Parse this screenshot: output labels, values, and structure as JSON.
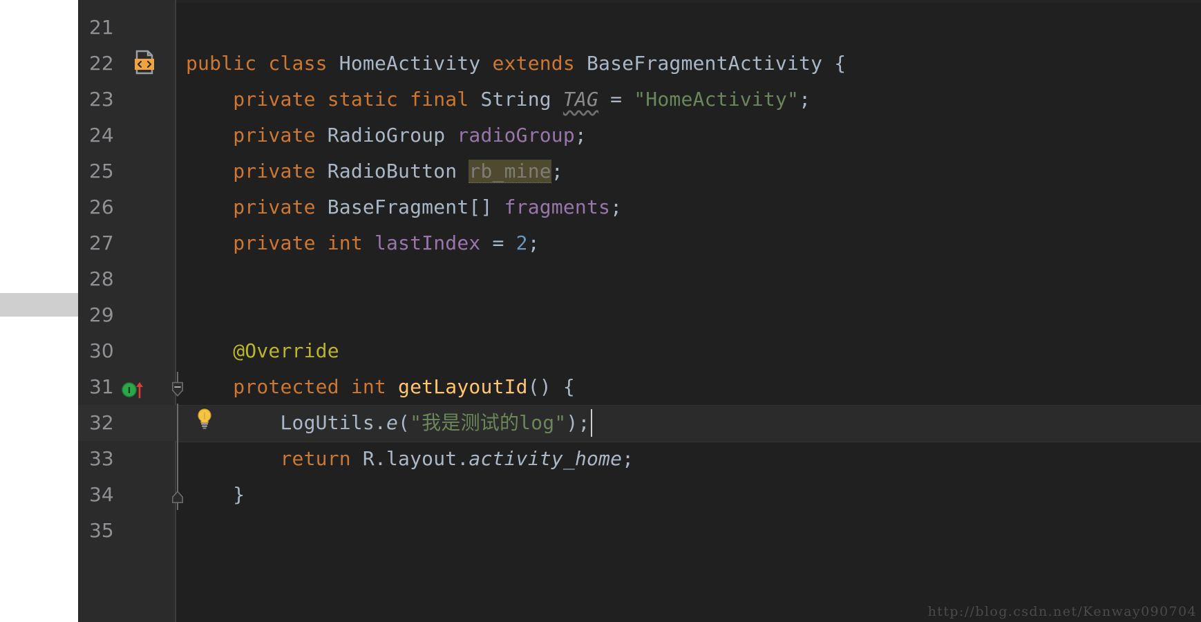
{
  "editor": {
    "theme": "darcula",
    "background": "#202020",
    "gutter_background": "#2b2b2c",
    "first_line_number": 21,
    "current_line_number": 32,
    "lines": [
      {
        "number": "21",
        "segments": []
      },
      {
        "number": "22",
        "segments": [
          {
            "text": "public ",
            "cls": "kw"
          },
          {
            "text": "class ",
            "cls": "kw"
          },
          {
            "text": "HomeActivity ",
            "cls": "type"
          },
          {
            "text": "extends ",
            "cls": "kw"
          },
          {
            "text": "BaseFragmentActivity ",
            "cls": "type"
          },
          {
            "text": "{",
            "cls": "punc"
          }
        ]
      },
      {
        "number": "23",
        "segments": [
          {
            "text": "    private ",
            "cls": "kw"
          },
          {
            "text": "static ",
            "cls": "kw"
          },
          {
            "text": "final ",
            "cls": "kw"
          },
          {
            "text": "String ",
            "cls": "type"
          },
          {
            "text": "TAG",
            "cls": "stat wavy"
          },
          {
            "text": " = ",
            "cls": "punc"
          },
          {
            "text": "\"HomeActivity\"",
            "cls": "str"
          },
          {
            "text": ";",
            "cls": "punc"
          }
        ]
      },
      {
        "number": "24",
        "segments": [
          {
            "text": "    private ",
            "cls": "kw"
          },
          {
            "text": "RadioGroup ",
            "cls": "type"
          },
          {
            "text": "radioGroup",
            "cls": "fld"
          },
          {
            "text": ";",
            "cls": "punc"
          }
        ]
      },
      {
        "number": "25",
        "segments": [
          {
            "text": "    private ",
            "cls": "kw"
          },
          {
            "text": "RadioButton ",
            "cls": "type"
          },
          {
            "text": "rb_mine",
            "cls": "sel-hl"
          },
          {
            "text": ";",
            "cls": "punc"
          }
        ]
      },
      {
        "number": "26",
        "segments": [
          {
            "text": "    private ",
            "cls": "kw"
          },
          {
            "text": "BaseFragment[] ",
            "cls": "type"
          },
          {
            "text": "fragments",
            "cls": "fld"
          },
          {
            "text": ";",
            "cls": "punc"
          }
        ]
      },
      {
        "number": "27",
        "segments": [
          {
            "text": "    private ",
            "cls": "kw"
          },
          {
            "text": "int ",
            "cls": "kw"
          },
          {
            "text": "lastIndex",
            "cls": "fld"
          },
          {
            "text": " = ",
            "cls": "punc"
          },
          {
            "text": "2",
            "cls": "num"
          },
          {
            "text": ";",
            "cls": "punc"
          }
        ]
      },
      {
        "number": "28",
        "segments": []
      },
      {
        "number": "29",
        "segments": []
      },
      {
        "number": "30",
        "segments": [
          {
            "text": "    @Override",
            "cls": "anno"
          }
        ]
      },
      {
        "number": "31",
        "segments": [
          {
            "text": "    protected ",
            "cls": "kw"
          },
          {
            "text": "int ",
            "cls": "kw"
          },
          {
            "text": "getLayoutId",
            "cls": "mth"
          },
          {
            "text": "() {",
            "cls": "punc"
          }
        ]
      },
      {
        "number": "32",
        "segments": [
          {
            "text": "        LogUtils",
            "cls": "type"
          },
          {
            "text": ".",
            "cls": "punc"
          },
          {
            "text": "e",
            "cls": "ital"
          },
          {
            "text": "(",
            "cls": "punc"
          },
          {
            "text": "\"我是测试的log\"",
            "cls": "str"
          },
          {
            "text": ");",
            "cls": "punc"
          }
        ]
      },
      {
        "number": "33",
        "segments": [
          {
            "text": "        return ",
            "cls": "kw"
          },
          {
            "text": "R",
            "cls": "type"
          },
          {
            "text": ".",
            "cls": "punc"
          },
          {
            "text": "layout",
            "cls": "type"
          },
          {
            "text": ".",
            "cls": "punc"
          },
          {
            "text": "activity_home",
            "cls": "fld ital"
          },
          {
            "text": ";",
            "cls": "punc"
          }
        ]
      },
      {
        "number": "34",
        "segments": [
          {
            "text": "    }",
            "cls": "punc"
          }
        ]
      },
      {
        "number": "35",
        "segments": []
      }
    ],
    "gutter_icons": [
      {
        "name": "xml-layout-icon",
        "line": "22",
        "glyph": "<>"
      },
      {
        "name": "implementing-method-icon",
        "line": "31",
        "glyph": "I"
      },
      {
        "name": "intention-bulb-icon",
        "line": "32",
        "glyph": "bulb"
      }
    ],
    "fold_markers": [
      {
        "name": "fold-collapse-marker",
        "line": "31",
        "glyph": "-"
      },
      {
        "name": "fold-end-marker",
        "line": "34",
        "glyph": "end"
      }
    ],
    "caret": {
      "line": "32",
      "visible": true
    }
  },
  "watermark": {
    "text": "http://blog.csdn.net/Kenway090704"
  },
  "colors": {
    "keyword": "#CC7832",
    "type": "#A9B7C6",
    "field": "#9876AA",
    "string": "#6A8759",
    "number": "#6897BB",
    "method": "#FFC66D",
    "annotation": "#BBB529",
    "static_italic": "#8C8C8C",
    "selection_highlight": "#4E4A30",
    "line_number": "#8F9194",
    "editor_bg": "#202020",
    "gutter_bg": "#2B2B2C",
    "current_line_bg": "#2B2B2B"
  }
}
